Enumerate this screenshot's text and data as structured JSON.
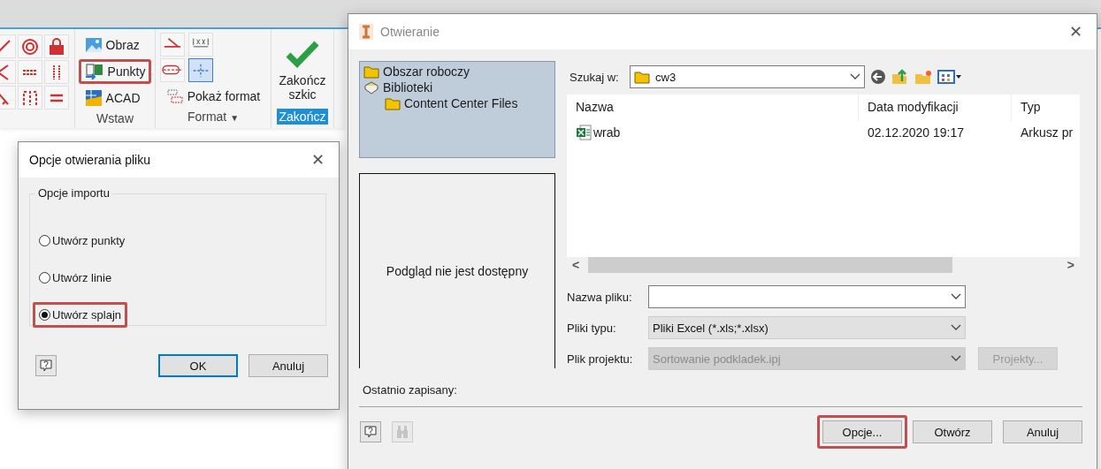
{
  "ribbon": {
    "wstaw": {
      "label": "Wstaw",
      "items": [
        {
          "label": "Obraz",
          "highlighted": false
        },
        {
          "label": "Punkty",
          "highlighted": true
        },
        {
          "label": "ACAD",
          "highlighted": false
        }
      ]
    },
    "format": {
      "label": "Format",
      "tools": [
        {
          "selected": false
        },
        {
          "selected": false
        },
        {
          "selected": false
        },
        {
          "selected": true
        }
      ],
      "show_format": "Pokaż format",
      "caret": "▼"
    },
    "finish": {
      "button": "Zakończ szkic",
      "label": "Zakończ"
    }
  },
  "options_dialog": {
    "title": "Opcje otwierania pliku",
    "close": "✕",
    "group": {
      "label": "Opcje importu",
      "options": [
        {
          "label": "Utwórz punkty",
          "selected": false,
          "highlighted": false
        },
        {
          "label": "Utwórz linie",
          "selected": false,
          "highlighted": false
        },
        {
          "label": "Utwórz splajn",
          "selected": true,
          "highlighted": true
        }
      ]
    },
    "buttons": [
      {
        "label": "OK",
        "default": true
      },
      {
        "label": "Anuluj",
        "default": false
      }
    ]
  },
  "open_dialog": {
    "title": "Otwieranie",
    "close": "✕",
    "places": [
      {
        "label": "Obszar roboczy",
        "kind": "folder"
      },
      {
        "label": "Biblioteki",
        "kind": "library",
        "children": [
          {
            "label": "Content Center Files",
            "kind": "folder"
          }
        ]
      }
    ],
    "preview_text": "Podgląd nie jest dostępny",
    "look_in": {
      "label": "Szukaj w:",
      "value": "cw3"
    },
    "columns": [
      "Nazwa",
      "Data modyfikacji",
      "Typ"
    ],
    "rows": [
      {
        "cells": [
          "wrab",
          "02.12.2020 19:17",
          "Arkusz pr"
        ]
      }
    ],
    "scroll_left": "<",
    "scroll_right": ">",
    "file_name": {
      "label": "Nazwa pliku:"
    },
    "file_type": {
      "label": "Pliki typu:",
      "value": "Pliki Excel (*.xls;*.xlsx)"
    },
    "project_file": {
      "label": "Plik projektu:",
      "value": "Sortowanie podkladek.ipj",
      "disabled": true
    },
    "projects_button": {
      "label": "Projekty...",
      "disabled": true
    },
    "recent_label": "Ostatnio zapisany:",
    "buttons": [
      {
        "label": "Opcje...",
        "highlighted": true
      },
      {
        "label": "Otwórz",
        "highlighted": false
      },
      {
        "label": "Anuluj",
        "highlighted": false
      }
    ]
  }
}
